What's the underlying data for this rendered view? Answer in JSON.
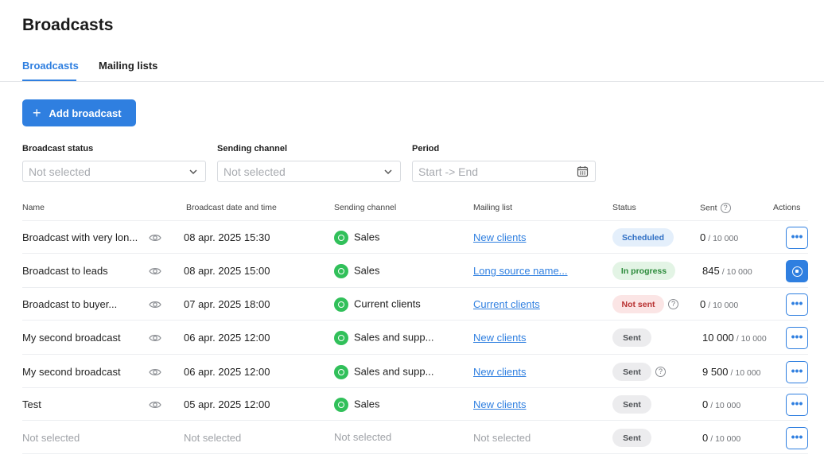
{
  "page": {
    "title": "Broadcasts"
  },
  "tabs": [
    {
      "label": "Broadcasts",
      "active": true
    },
    {
      "label": "Mailing lists",
      "active": false
    }
  ],
  "toolbar": {
    "add_label": "Add broadcast"
  },
  "filters": {
    "status": {
      "label": "Broadcast status",
      "value": "Not selected"
    },
    "channel": {
      "label": "Sending channel",
      "value": "Not selected"
    },
    "period": {
      "label": "Period",
      "value": "Start -> End"
    }
  },
  "table": {
    "headers": {
      "name": "Name",
      "date": "Broadcast date and time",
      "channel": "Sending channel",
      "list": "Mailing list",
      "status": "Status",
      "sent": "Sent",
      "actions": "Actions"
    },
    "rows": [
      {
        "name": "Broadcast with very lon...",
        "date": "08 apr. 2025  15:30",
        "channel": "Sales",
        "list": "New clients",
        "status": "Scheduled",
        "sent": "0",
        "total": "/ 10 000",
        "action": "more"
      },
      {
        "name": " Broadcast to leads",
        "date": "08 apr. 2025 15:00",
        "channel": "Sales",
        "list": "Long source name...",
        "status": "In progress",
        "sent": "845",
        "total": "/ 10 000",
        "action": "stop"
      },
      {
        "name": "Broadcast to buyer...",
        "date": "07 apr. 2025 18:00",
        "channel": "Current clients",
        "list": "Current clients",
        "status": "Not sent",
        "sent": "0",
        "total": "/ 10 000",
        "action": "more"
      },
      {
        "name": "My second broadcast",
        "date": "06 apr. 2025 12:00",
        "channel": "Sales and supp...",
        "list": "New clients",
        "status": "Sent",
        "sent": "10 000",
        "total": "/ 10 000",
        "action": "more"
      },
      {
        "name": "My second broadcast",
        "date": "06 apr. 2025 12:00",
        "channel": "Sales and supp...",
        "list": "New clients",
        "status": "Sent",
        "sent": "9 500",
        "total": "/ 10 000",
        "action": "more"
      },
      {
        "name": "Test",
        "date": "05 apr. 2025 12:00",
        "channel": "Sales",
        "list": "New clients",
        "status": "Sent",
        "sent": "0",
        "total": "/ 10 000",
        "action": "more"
      },
      {
        "name": "Not selected",
        "date": "Not selected",
        "channel": "Not selected",
        "list": "Not selected",
        "status": "Sent",
        "sent": "0",
        "total": "/ 10 000",
        "action": "more"
      }
    ]
  },
  "colors": {
    "accent": "#2f7fe0",
    "whatsapp": "#31c05a"
  }
}
